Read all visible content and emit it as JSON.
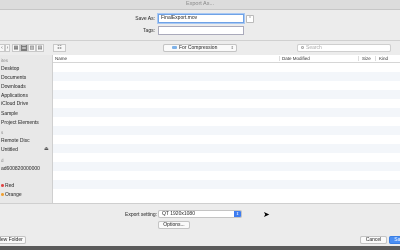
{
  "window": {
    "title": "Export As..."
  },
  "save": {
    "label": "Save As:",
    "value": "FinalExport.mov",
    "tags_label": "Tags:",
    "tags_value": "",
    "expand": "⌃"
  },
  "toolbar": {
    "back": "‹",
    "forward": "›",
    "views": [
      "☰",
      "▦",
      "▥",
      "▤"
    ],
    "arrange": "☷",
    "location": "For Compression",
    "search_placeholder": "Search"
  },
  "sidebar": {
    "sections": [
      {
        "header": "ites",
        "items": [
          "Desktop",
          "Documents",
          "Downloads",
          "Applications",
          "iCloud Drive",
          "Sample",
          "Project Elements"
        ]
      },
      {
        "header": "s",
        "items": [
          "Remote Disc",
          "Untitled"
        ]
      },
      {
        "header": "d",
        "items": [
          "ad600820000000"
        ]
      },
      {
        "header": "",
        "items": [
          "Red",
          "Orange"
        ]
      }
    ],
    "eject": "⏏"
  },
  "list": {
    "columns": [
      "Name",
      "Date Modified",
      "Size",
      "Kind"
    ]
  },
  "export": {
    "label": "Export setting:",
    "value": "QT 1920x1080",
    "options_label": "Options..."
  },
  "footer": {
    "new_folder": "New Folder",
    "cancel": "Cancel",
    "save": "Save"
  },
  "colors": {
    "accent": "#4a8ef3",
    "background": "#ececec"
  }
}
